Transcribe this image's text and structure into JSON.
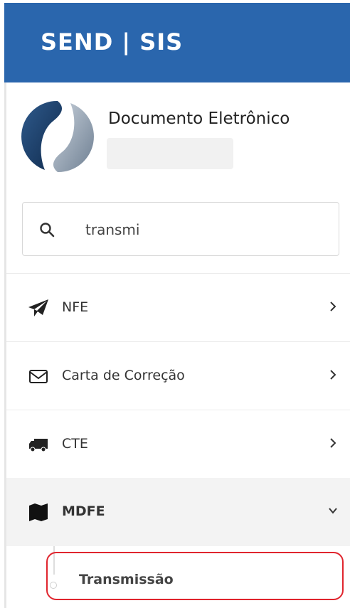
{
  "header": {
    "brand": "SEND | SIS"
  },
  "profile": {
    "title": "Documento Eletrônico",
    "logo_icon": "send-sis-logo"
  },
  "search": {
    "value": "transmi",
    "icon": "search-icon"
  },
  "menu": {
    "items": [
      {
        "label": "NFE",
        "icon": "paper-plane-icon",
        "expanded": false
      },
      {
        "label": "Carta de Correção",
        "icon": "envelope-icon",
        "expanded": false
      },
      {
        "label": "CTE",
        "icon": "truck-icon",
        "expanded": false
      },
      {
        "label": "MDFE",
        "icon": "map-icon",
        "expanded": true,
        "children": [
          {
            "label": "Transmissão",
            "highlighted": true
          }
        ]
      }
    ]
  },
  "colors": {
    "header_bg": "#2a66ad",
    "highlight_border": "#e0252e"
  }
}
